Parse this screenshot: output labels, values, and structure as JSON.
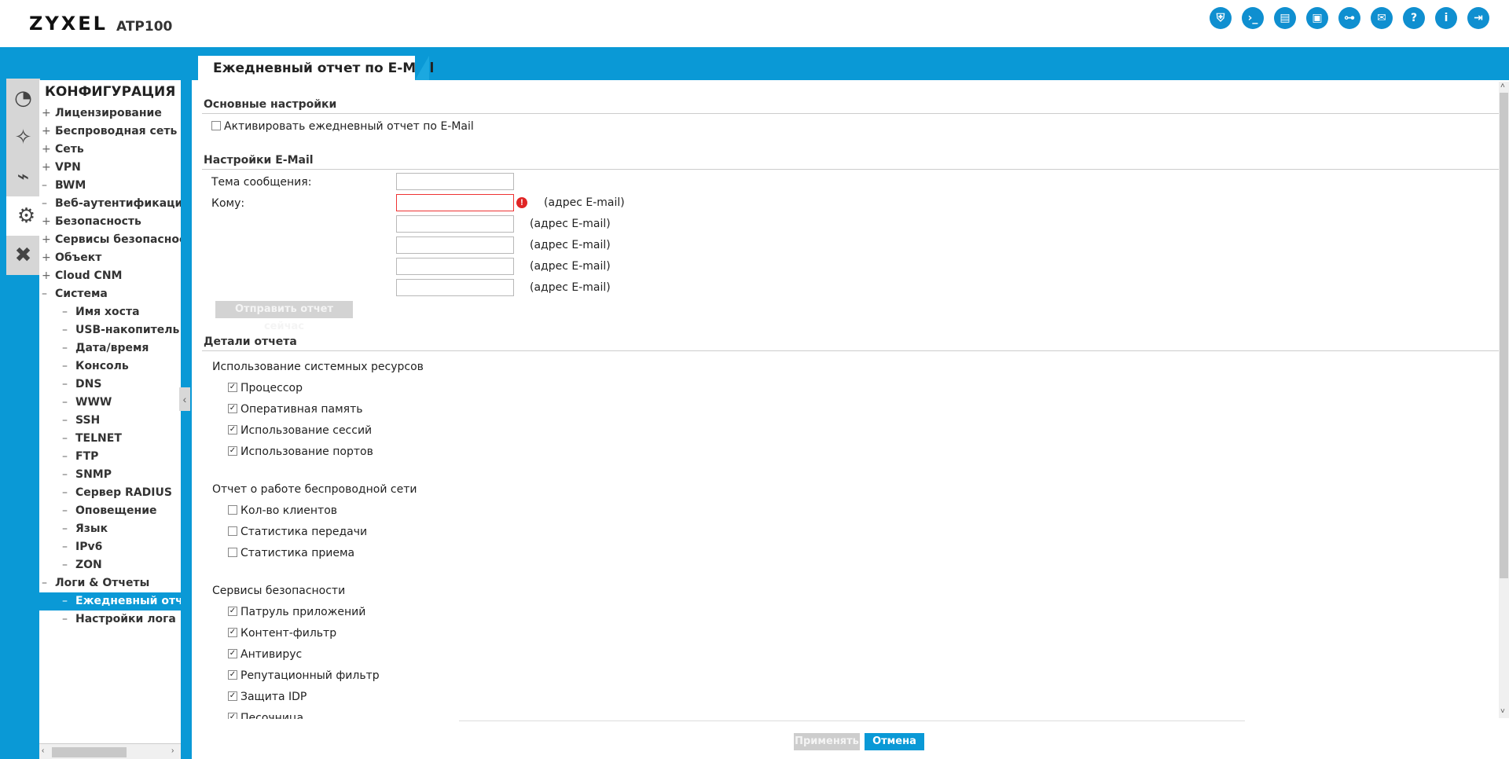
{
  "header": {
    "logo": "ZYXEL",
    "model": "ATP100",
    "icons": [
      "shield-icon",
      "console-icon",
      "cli-icon",
      "window-icon",
      "network-icon",
      "chat-icon",
      "help-icon",
      "info-icon",
      "logout-icon"
    ]
  },
  "sidebar": {
    "title": "КОНФИГУРАЦИЯ",
    "items": [
      {
        "label": "Лицензирование",
        "mark": "+"
      },
      {
        "label": "Беспроводная сеть",
        "mark": "+"
      },
      {
        "label": "Сеть",
        "mark": "+"
      },
      {
        "label": "VPN",
        "mark": "+"
      },
      {
        "label": "BWM",
        "mark": "–"
      },
      {
        "label": "Веб-аутентификация",
        "mark": "–"
      },
      {
        "label": "Безопасность",
        "mark": "+"
      },
      {
        "label": "Сервисы безопасности",
        "mark": "+"
      },
      {
        "label": "Объект",
        "mark": "+"
      },
      {
        "label": "Cloud CNM",
        "mark": "+"
      },
      {
        "label": "Система",
        "mark": "–"
      },
      {
        "label": "Имя хоста",
        "mark": "–"
      },
      {
        "label": "USB-накопитель",
        "mark": "–"
      },
      {
        "label": "Дата/время",
        "mark": "–"
      },
      {
        "label": "Консоль",
        "mark": "–"
      },
      {
        "label": "DNS",
        "mark": "–"
      },
      {
        "label": "WWW",
        "mark": "–"
      },
      {
        "label": "SSH",
        "mark": "–"
      },
      {
        "label": "TELNET",
        "mark": "–"
      },
      {
        "label": "FTP",
        "mark": "–"
      },
      {
        "label": "SNMP",
        "mark": "–"
      },
      {
        "label": "Сервер RADIUS",
        "mark": "–"
      },
      {
        "label": "Оповещение",
        "mark": "–"
      },
      {
        "label": "Язык",
        "mark": "–"
      },
      {
        "label": "IPv6",
        "mark": "–"
      },
      {
        "label": "ZON",
        "mark": "–"
      },
      {
        "label": "Логи & Отчеты",
        "mark": "–"
      },
      {
        "label": "Ежедневный отчет",
        "mark": "–"
      },
      {
        "label": "Настройки лога",
        "mark": "–"
      }
    ]
  },
  "tab": {
    "label": "Ежедневный отчет по E-Mail"
  },
  "basic": {
    "heading": "Основные настройки",
    "activate_label": "Активировать ежедневный отчет по E-Mail",
    "activate_checked": false
  },
  "email": {
    "heading": "Настройки E-Mail",
    "subject_label": "Тема сообщения:",
    "subject_value": "",
    "to_label": "Кому:",
    "addr_hint": "(адрес E-mail)",
    "recipients": [
      "",
      "",
      "",
      "",
      ""
    ],
    "send_now": "Отправить отчет сейчас"
  },
  "details": {
    "heading": "Детали отчета",
    "groups": [
      {
        "title": "Использование системных ресурсов",
        "items": [
          {
            "label": "Процессор",
            "checked": true
          },
          {
            "label": "Оперативная память",
            "checked": true
          },
          {
            "label": "Использование сессий",
            "checked": true
          },
          {
            "label": "Использование портов",
            "checked": true
          }
        ]
      },
      {
        "title": "Отчет о работе беспроводной сети",
        "items": [
          {
            "label": "Кол-во клиентов",
            "checked": false
          },
          {
            "label": "Статистика передачи",
            "checked": false
          },
          {
            "label": "Статистика приема",
            "checked": false
          }
        ]
      },
      {
        "title": "Сервисы безопасности",
        "items": [
          {
            "label": "Патруль приложений",
            "checked": true
          },
          {
            "label": "Контент-фильтр",
            "checked": true
          },
          {
            "label": "Антивирус",
            "checked": true
          },
          {
            "label": "Репутационный фильтр",
            "checked": true
          },
          {
            "label": "Защита IDP",
            "checked": true
          },
          {
            "label": "Песочница",
            "checked": true
          }
        ]
      }
    ]
  },
  "footer": {
    "apply": "Применять",
    "cancel": "Отмена"
  },
  "colors": {
    "accent": "#0a99d6",
    "error": "#e02424"
  }
}
